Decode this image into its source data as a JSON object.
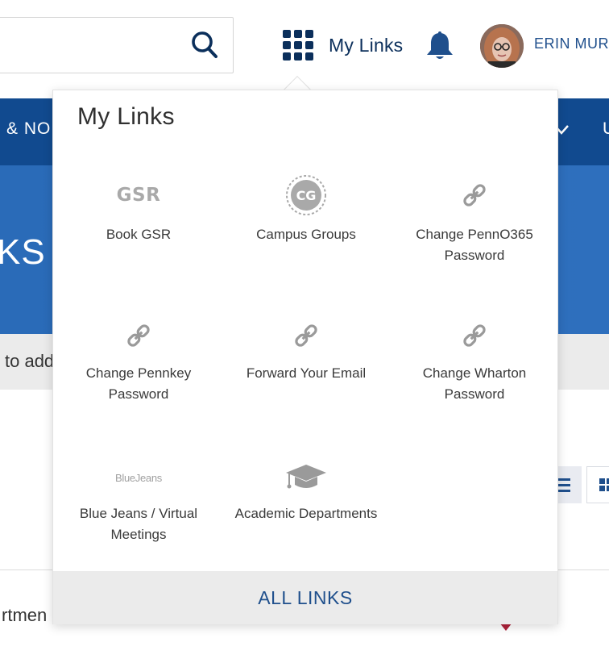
{
  "header": {
    "search": {
      "placeholder": "",
      "icon": "search-icon"
    },
    "my_links_label": "My Links",
    "user_name": "ERIN MURF",
    "colors": {
      "navy": "#0b2f5b",
      "link_blue": "#1f4f8c"
    }
  },
  "background": {
    "nav_left": "& NO",
    "nav_right": "U",
    "hero_title": "KS",
    "info_text": "to add",
    "row_text": "rtmen",
    "colors": {
      "nav": "#114a8f",
      "hero": "#2a6bb8",
      "info_bar": "#ebebeb",
      "marker": "#b0233b"
    }
  },
  "dropdown": {
    "title": "My Links",
    "links": [
      {
        "label": "Book GSR",
        "icon": "gsr-logo",
        "icon_text": "GSR"
      },
      {
        "label": "Campus Groups",
        "icon": "campus-groups-logo",
        "icon_text": "CG"
      },
      {
        "label": "Change PennO365 Password",
        "icon": "link-icon"
      },
      {
        "label": "Change Pennkey Password",
        "icon": "link-icon"
      },
      {
        "label": "Forward Your Email",
        "icon": "link-icon"
      },
      {
        "label": "Change Wharton Password",
        "icon": "link-icon"
      },
      {
        "label": "Blue Jeans / Virtual Meetings",
        "icon": "bluejeans-logo",
        "icon_text": "BlueJeans"
      },
      {
        "label": "Academic Departments",
        "icon": "graduation-cap-icon"
      }
    ],
    "all_links_label": "ALL LINKS"
  }
}
